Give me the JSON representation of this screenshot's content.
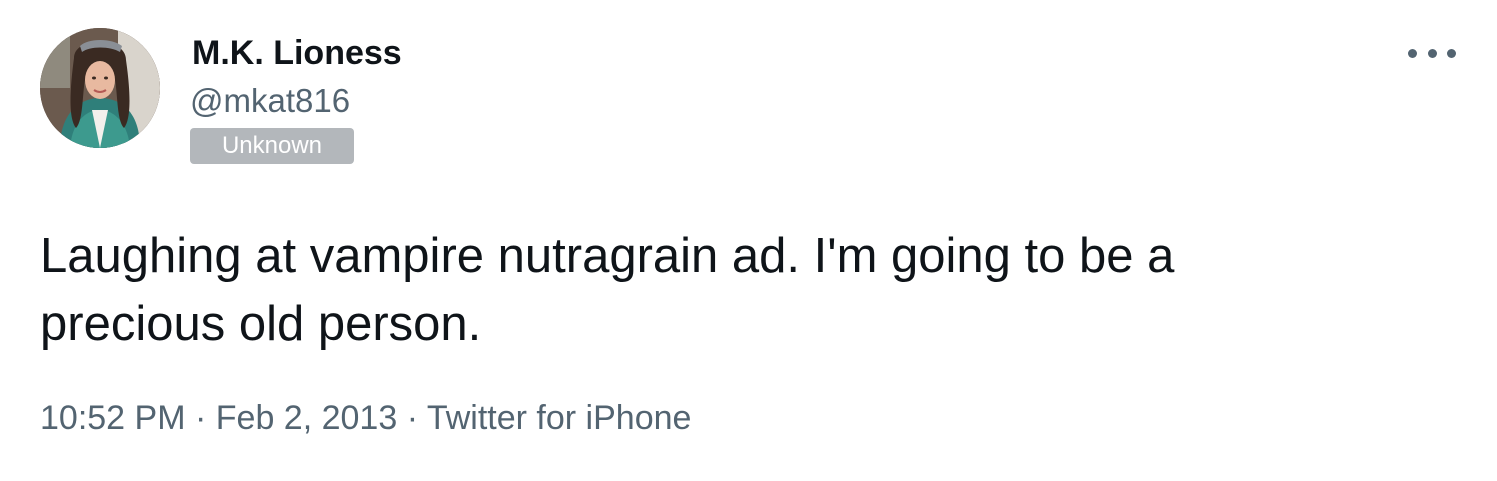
{
  "author": {
    "name": "M.K. Lioness",
    "handle": "@mkat816",
    "label": "Unknown"
  },
  "tweet": {
    "text": "Laughing at vampire nutragrain ad. I'm going to be a precious old person.",
    "time": "10:52 PM",
    "separator": "·",
    "date": "Feb 2, 2013",
    "source": "Twitter for iPhone"
  },
  "icons": {
    "more": "more-horizontal-icon"
  },
  "colors": {
    "text_primary": "#0f1419",
    "text_secondary": "#536471",
    "badge_bg": "#b3b7bb",
    "background": "#ffffff"
  }
}
